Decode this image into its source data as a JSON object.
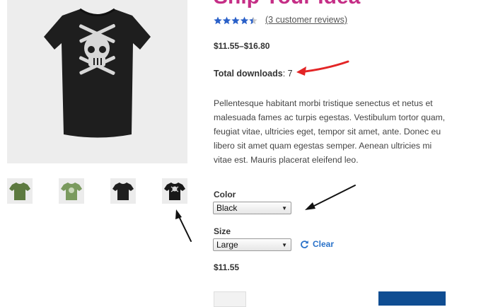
{
  "product": {
    "title": "Ship Your Idea",
    "rating_stars": 4.4,
    "reviews_link": "(3 customer reviews)",
    "price_range": "$11.55–$16.80",
    "downloads_label": "Total downloads",
    "downloads_sep": ": ",
    "downloads_value": "7",
    "description": "Pellentesque habitant morbi tristique senectus et netus et malesuada fames ac turpis egestas. Vestibulum tortor quam, feugiat vitae, ultricies eget, tempor sit amet, ante. Donec eu libero sit amet quam egestas semper. Aenean ultricies mi vitae est. Mauris placerat eleifend leo."
  },
  "variations": {
    "color_label": "Color",
    "color_value": "Black",
    "size_label": "Size",
    "size_value": "Large",
    "clear_label": "Clear",
    "variation_price": "$11.55"
  },
  "colors": {
    "title": "#c52e86",
    "star": "#2a60c8",
    "annotation_red": "#e32526",
    "annotation_black": "#111111",
    "link": "#2a72c9",
    "button": "#0f4d92"
  },
  "icons": {
    "thumbnail_colors": [
      "#5d7a40",
      "#7a9a5e",
      "#1f1f1f",
      "#181818"
    ]
  }
}
